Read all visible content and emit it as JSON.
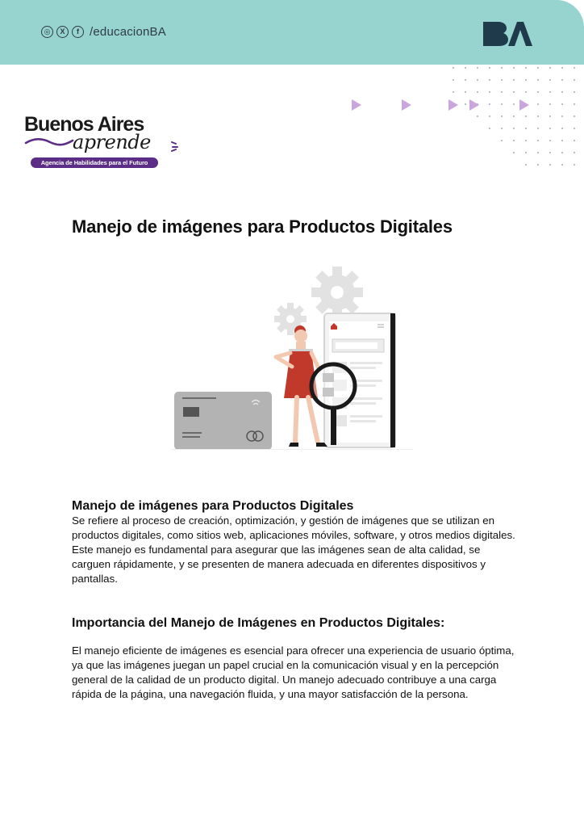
{
  "header": {
    "social_handle": "/educacionBA",
    "social_icons": [
      "instagram-icon",
      "x-icon",
      "facebook-icon"
    ],
    "logo_text": "BA",
    "background_color": "#97d3cf",
    "logo_color": "#1f3a4a"
  },
  "brand": {
    "line1": "Buenos Aires",
    "line2": "aprende",
    "tagline": "Agencia de Habilidades para el Futuro",
    "accent_color": "#5b2d86"
  },
  "title": "Manejo de imágenes para Productos Digitales",
  "section1": {
    "heading": "Manejo de imágenes para Productos Digitales",
    "body": "Se refiere al proceso de creación, optimización, y gestión de imágenes que se utilizan en productos digitales, como sitios web, aplicaciones móviles, software, y otros medios digitales. Este manejo es fundamental para asegurar que las imágenes sean de alta calidad, se carguen rápidamente, y se presenten de manera adecuada en diferentes dispositivos y pantallas."
  },
  "section2": {
    "heading": "Importancia del Manejo de Imágenes en Productos Digitales:",
    "body": "El manejo eficiente de imágenes es esencial para ofrecer una experiencia de usuario óptima, ya que las imágenes juegan un papel crucial en la comunicación visual y en la percepción general de la calidad de un producto digital. Un manejo adecuado contribuye a una carga rápida de la página, una navegación fluida, y una mayor satisfacción de la persona."
  },
  "decor": {
    "arrow_color": "#c9a6dc",
    "dot_color": "#b6b6c8"
  }
}
